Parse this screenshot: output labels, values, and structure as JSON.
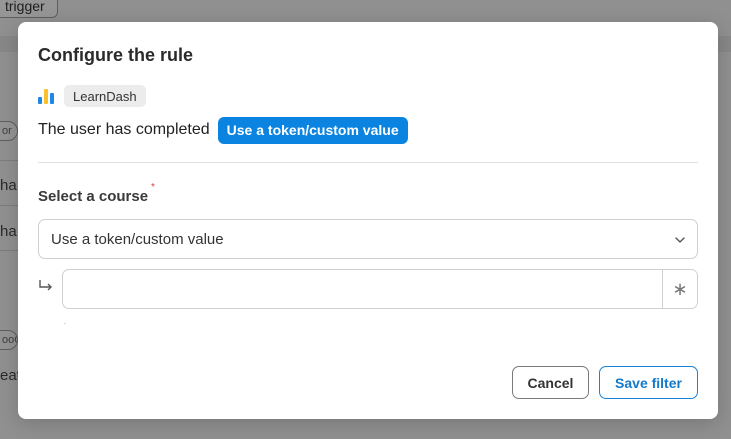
{
  "background": {
    "trigger_button_label": "trigger",
    "row_chip_label": "or",
    "row1_text": "ha",
    "row2_text": "ha",
    "row3_chip_label": "ooC",
    "row4_text": "eate"
  },
  "modal": {
    "title": "Configure the rule",
    "app": {
      "name": "LearnDash",
      "icon": "bar-chart-icon",
      "icon_colors": [
        "#1e88e5",
        "#fbc02d",
        "#1e88e5"
      ]
    },
    "sentence": {
      "text": "The user has completed",
      "token_label": "Use a token/custom value",
      "token_color": "#0a84e0"
    },
    "course_field": {
      "label": "Select a course",
      "required_mark": "*",
      "selected_value": "Use a token/custom value",
      "custom_value_input": {
        "value": "",
        "placeholder": ""
      },
      "token_button_icon": "asterisk-icon",
      "token_button_glyph": "∗"
    },
    "buttons": {
      "cancel_label": "Cancel",
      "save_label": "Save filter"
    }
  }
}
